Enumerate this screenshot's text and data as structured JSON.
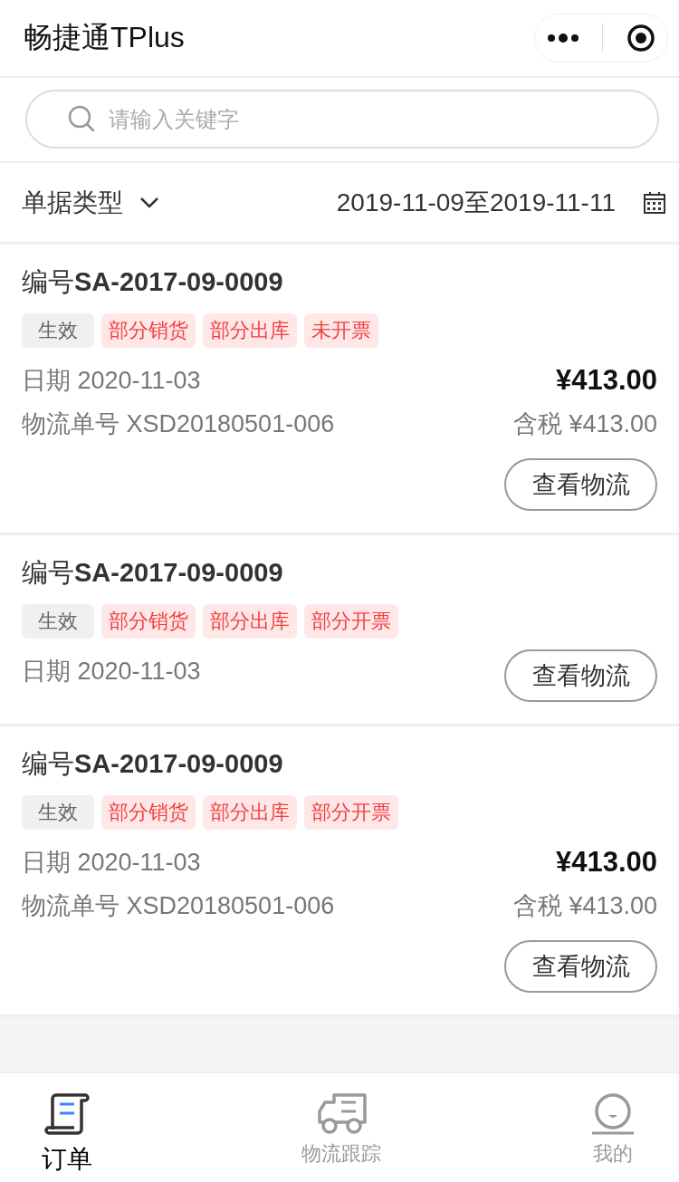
{
  "title": "畅捷通TPlus",
  "search": {
    "placeholder": "请输入关键字"
  },
  "filter": {
    "type_label": "单据类型",
    "date_range": "2019-11-09至2019-11-11"
  },
  "orders": [
    {
      "number": "编号**SA-2017-09-0009**",
      "tags": [
        {
          "label": "生效",
          "kind": "status"
        },
        {
          "label": "部分销货",
          "kind": "flag"
        },
        {
          "label": "部分出库",
          "kind": "flag"
        },
        {
          "label": "未开票",
          "kind": "flag"
        }
      ],
      "date": "日期 2020-11-03",
      "logistics_no": "物流单号 XSD20180501-006",
      "amount": "¥413.00",
      "tax": "含税 ¥413.00",
      "button": "查看物流"
    },
    {
      "number": "编号**SA-2017-09-0009**",
      "tags": [
        {
          "label": "生效",
          "kind": "status"
        },
        {
          "label": "部分销货",
          "kind": "flag"
        },
        {
          "label": "部分出库",
          "kind": "flag"
        },
        {
          "label": "部分开票",
          "kind": "flag"
        }
      ],
      "date": "日期 2020-11-03",
      "button": "查看物流"
    },
    {
      "number": "编号**SA-2017-09-0009**",
      "tags": [
        {
          "label": "生效",
          "kind": "status"
        },
        {
          "label": "部分销货",
          "kind": "flag"
        },
        {
          "label": "部分出库",
          "kind": "flag"
        },
        {
          "label": "部分开票",
          "kind": "flag"
        }
      ],
      "date": "日期 2020-11-03",
      "logistics_no": "物流单号 XSD20180501-006",
      "amount": "¥413.00",
      "tax": "含税 ¥413.00",
      "button": "查看物流"
    }
  ],
  "tabbar": [
    {
      "label": "订单",
      "kind": "order",
      "selected": true
    },
    {
      "label": "物流跟踪",
      "kind": "truck",
      "selected": false
    },
    {
      "label": "我的",
      "kind": "profile",
      "selected": false
    }
  ]
}
